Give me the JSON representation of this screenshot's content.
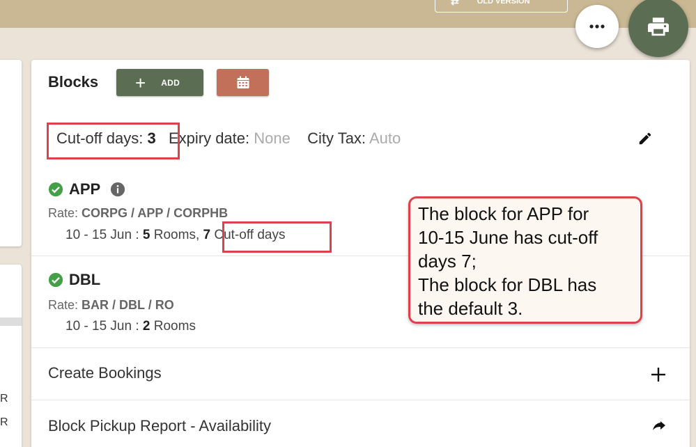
{
  "header": {
    "old_version_label": "OLD VERSION",
    "more_icon": "more-horizontal-icon",
    "print_icon": "print-icon"
  },
  "blocks": {
    "title": "Blocks",
    "add_label": "ADD",
    "calendar_icon": "calendar-icon",
    "cutoff_label": "Cut-off days:",
    "cutoff_value": "3",
    "expiry_label": "Expiry date:",
    "expiry_value": "None",
    "city_tax_label": "City Tax:",
    "city_tax_value": "Auto",
    "items": [
      {
        "name": "APP",
        "rate_label": "Rate:",
        "rate": "CORPG / APP / CORPHB",
        "dates": "10 - 15 Jun :",
        "rooms_count": "5",
        "rooms_label": "Rooms",
        "separator": ",",
        "cutoff_count": "7",
        "cutoff_label": "Cut-off days"
      },
      {
        "name": "DBL",
        "rate_label": "Rate:",
        "rate": "BAR / DBL / RO",
        "dates": "10 - 15 Jun :",
        "rooms_count": "2",
        "rooms_label": "Rooms"
      }
    ]
  },
  "actions": {
    "create_bookings": "Create Bookings",
    "pickup_report": "Block Pickup Report - Availability"
  },
  "callout": {
    "lines": [
      "The block for APP for",
      "10-15 June has cut-off",
      "days 7;",
      "The block for DBL has",
      "the default 3."
    ]
  },
  "left_panel": {
    "chars": [
      "R",
      "R"
    ]
  },
  "colors": {
    "topbar": "#c9b893",
    "background": "#ebe3d8",
    "primary_green": "#5b6e53",
    "calendar_terracotta": "#c3705a",
    "highlight_red": "#e0404a",
    "check_green": "#43a047"
  }
}
